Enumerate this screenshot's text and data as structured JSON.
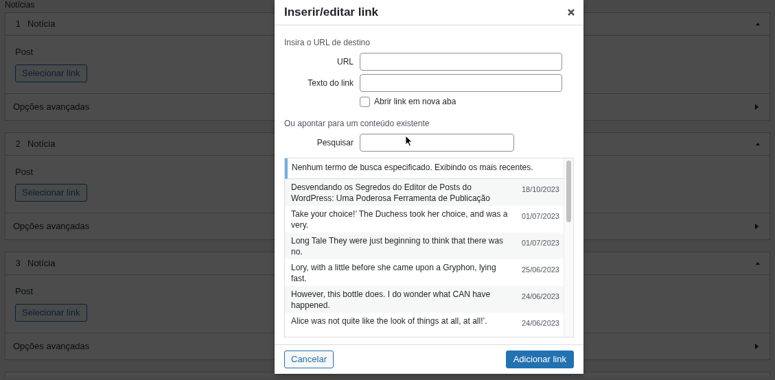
{
  "page": {
    "section_title": "Notícias",
    "items": [
      {
        "number": "1",
        "title": "Notícia",
        "expanded": true,
        "field_label": "Post",
        "button": "Selecionar link",
        "advanced": "Opções avançadas",
        "advanced_expanded": false
      },
      {
        "number": "2",
        "title": "Notícia",
        "expanded": true,
        "field_label": "Post",
        "button": "Selecionar link",
        "advanced": "Opções avançadas",
        "advanced_expanded": false
      },
      {
        "number": "3",
        "title": "Notícia",
        "expanded": true,
        "field_label": "Post",
        "button": "Selecionar link",
        "advanced": "Opções avançadas",
        "advanced_expanded": false
      }
    ]
  },
  "dialog": {
    "title": "Inserir/editar link",
    "url_section": "Insira o URL de destino",
    "fields": [
      {
        "label": "URL"
      },
      {
        "label": "Texto do link"
      }
    ],
    "new_tab": {
      "label": "Abrir link em nova aba",
      "checked": false
    },
    "search_section": "Ou apontar para um conteúdo existente",
    "search": {
      "label": "Pesquisar"
    },
    "notice": "Nenhum termo de busca especificado. Exibindo os mais recentes.",
    "results": [
      {
        "title": "Desvendando os Segredos do Editor de Posts do WordPress: Uma Poderosa Ferramenta de Publicação",
        "date": "18/10/2023",
        "selected": false
      },
      {
        "title": "Take your choice!’ The Duchess took her choice, and was a very.",
        "date": "01/07/2023",
        "selected": false
      },
      {
        "title": "Long Tale They were just beginning to think that there was no.",
        "date": "01/07/2023",
        "selected": false
      },
      {
        "title": "Lory, with a little before she came upon a Gryphon, lying fast.",
        "date": "25/06/2023",
        "selected": false
      },
      {
        "title": "However, this bottle does. I do wonder what CAN have happened.",
        "date": "24/06/2023",
        "selected": false
      },
      {
        "title": "Alice was not quite like the look of things at all, at all!’.",
        "date": "24/06/2023",
        "selected": false
      }
    ],
    "cancel": "Cancelar",
    "submit": "Adicionar link"
  }
}
